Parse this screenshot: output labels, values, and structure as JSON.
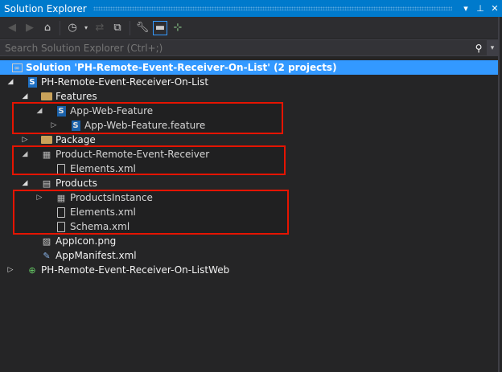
{
  "title_bar": {
    "title": "Solution Explorer",
    "dropdown_icon": "▾",
    "pin_icon": "⊥",
    "close_icon": "✕"
  },
  "search": {
    "placeholder": "Search Solution Explorer (Ctrl+;)",
    "value": ""
  },
  "tree": [
    {
      "label": "Solution 'PH-Remote-Event-Receiver-On-List' (2 projects)",
      "level": 0,
      "expander": "",
      "icon": "solution",
      "selected": true
    },
    {
      "label": "PH-Remote-Event-Receiver-On-List",
      "level": 1,
      "expander": "expanded",
      "icon": "sharepoint-project"
    },
    {
      "label": "Features",
      "level": 2,
      "expander": "expanded",
      "icon": "folder-open"
    },
    {
      "label": "App-Web-Feature",
      "level": 3,
      "expander": "expanded",
      "icon": "feature"
    },
    {
      "label": "App-Web-Feature.feature",
      "level": 4,
      "expander": "collapsed",
      "icon": "feature"
    },
    {
      "label": "Package",
      "level": 2,
      "expander": "collapsed",
      "icon": "folder"
    },
    {
      "label": "Product-Remote-Event-Receiver",
      "level": 2,
      "expander": "expanded",
      "icon": "event-receiver"
    },
    {
      "label": "Elements.xml",
      "level": 3,
      "expander": "",
      "icon": "xml-file"
    },
    {
      "label": "Products",
      "level": 2,
      "expander": "expanded",
      "icon": "list"
    },
    {
      "label": "ProductsInstance",
      "level": 3,
      "expander": "collapsed",
      "icon": "table"
    },
    {
      "label": "Elements.xml",
      "level": 3,
      "expander": "",
      "icon": "xml-file"
    },
    {
      "label": "Schema.xml",
      "level": 3,
      "expander": "",
      "icon": "xml-file"
    },
    {
      "label": "AppIcon.png",
      "level": 2,
      "expander": "",
      "icon": "image"
    },
    {
      "label": "AppManifest.xml",
      "level": 2,
      "expander": "",
      "icon": "manifest"
    },
    {
      "label": "PH-Remote-Event-Receiver-On-ListWeb",
      "level": 1,
      "expander": "collapsed",
      "icon": "web-project"
    }
  ]
}
